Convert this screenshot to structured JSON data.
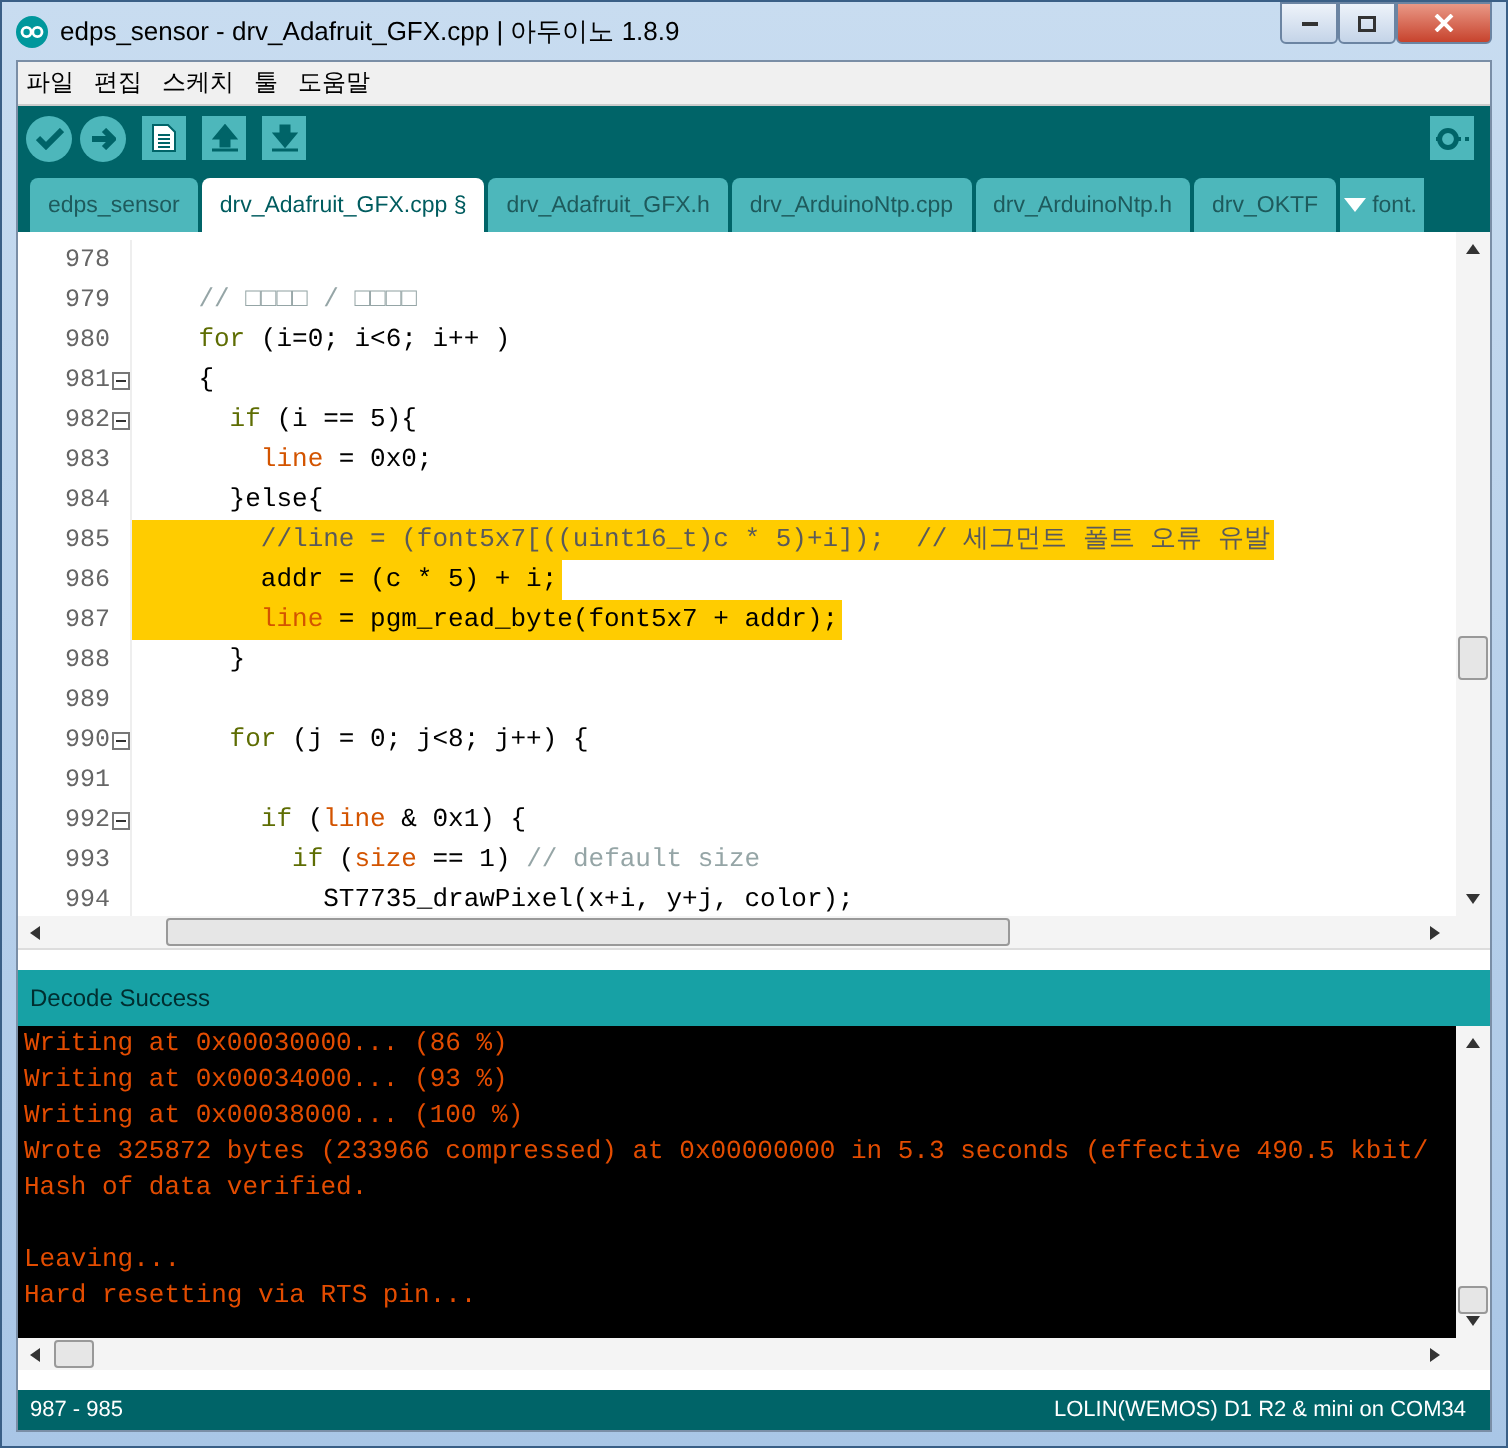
{
  "window": {
    "title": "edps_sensor - drv_Adafruit_GFX.cpp | 아두이노 1.8.9"
  },
  "menu": [
    "파일",
    "편집",
    "스케치",
    "툴",
    "도움말"
  ],
  "toolbar": [
    {
      "kind": "verify"
    },
    {
      "kind": "upload"
    },
    {
      "kind": "new"
    },
    {
      "kind": "open"
    },
    {
      "kind": "save"
    }
  ],
  "tabs": [
    {
      "label": "edps_sensor",
      "selected": false
    },
    {
      "label": "drv_Adafruit_GFX.cpp §",
      "selected": true
    },
    {
      "label": "drv_Adafruit_GFX.h",
      "selected": false
    },
    {
      "label": "drv_ArduinoNtp.cpp",
      "selected": false
    },
    {
      "label": "drv_ArduinoNtp.h",
      "selected": false
    },
    {
      "label": "drv_OKTF",
      "selected": false
    }
  ],
  "tab_overflow": {
    "label": "font."
  },
  "editor": {
    "lines": [
      {
        "number": "978",
        "fold": false,
        "highlighted": false
      },
      {
        "number": "979",
        "fold": false,
        "highlighted": false,
        "tokens": [
          {
            "kind": "comment",
            "text": "    // □□□□ / □□□□"
          }
        ]
      },
      {
        "number": "980",
        "fold": false,
        "highlighted": false,
        "tokens": [
          {
            "kind": "keyword",
            "text": "    for"
          },
          {
            "kind": "plain",
            "text": " (i=0; i<6; i++ )"
          }
        ]
      },
      {
        "number": "981",
        "fold": true,
        "highlighted": false,
        "tokens": [
          {
            "kind": "plain",
            "text": "    {"
          }
        ]
      },
      {
        "number": "982",
        "fold": true,
        "highlighted": false,
        "tokens": [
          {
            "kind": "keyword",
            "text": "      if"
          },
          {
            "kind": "plain",
            "text": " (i == 5){"
          }
        ]
      },
      {
        "number": "983",
        "fold": false,
        "highlighted": false,
        "tokens": [
          {
            "kind": "variable",
            "text": "        line"
          },
          {
            "kind": "plain",
            "text": " = 0x0;"
          }
        ]
      },
      {
        "number": "984",
        "fold": false,
        "highlighted": false,
        "tokens": [
          {
            "kind": "plain",
            "text": "      }else{"
          }
        ]
      },
      {
        "number": "985",
        "fold": false,
        "highlighted": true,
        "tokens": [
          {
            "kind": "comment",
            "text": "        //line = (font5x7[((uint16_t)c * 5)+i]);  // 세그먼트 폴트 오류 유발"
          }
        ]
      },
      {
        "number": "986",
        "fold": false,
        "highlighted": true,
        "tokens": [
          {
            "kind": "plain",
            "text": "        addr = (c * 5) + i;"
          }
        ]
      },
      {
        "number": "987",
        "fold": false,
        "highlighted": true,
        "tokens": [
          {
            "kind": "variable",
            "text": "        line"
          },
          {
            "kind": "plain",
            "text": " = pgm_read_byte(font5x7 + addr);"
          }
        ]
      },
      {
        "number": "988",
        "fold": false,
        "highlighted": false,
        "tokens": [
          {
            "kind": "plain",
            "text": "      }"
          }
        ]
      },
      {
        "number": "989",
        "fold": false,
        "highlighted": false
      },
      {
        "number": "990",
        "fold": true,
        "highlighted": false,
        "tokens": [
          {
            "kind": "keyword",
            "text": "      for"
          },
          {
            "kind": "plain",
            "text": " (j = 0; j<8; j++) {"
          }
        ]
      },
      {
        "number": "991",
        "fold": false,
        "highlighted": false
      },
      {
        "number": "992",
        "fold": true,
        "highlighted": false,
        "tokens": [
          {
            "kind": "keyword",
            "text": "        if"
          },
          {
            "kind": "plain",
            "text": " ("
          },
          {
            "kind": "variable",
            "text": "line"
          },
          {
            "kind": "plain",
            "text": " & 0x1) {"
          }
        ]
      },
      {
        "number": "993",
        "fold": false,
        "highlighted": false,
        "tokens": [
          {
            "kind": "keyword",
            "text": "          if"
          },
          {
            "kind": "plain",
            "text": " ("
          },
          {
            "kind": "variable",
            "text": "size"
          },
          {
            "kind": "plain",
            "text": " == 1) "
          },
          {
            "kind": "comment",
            "text": "// default size"
          }
        ]
      },
      {
        "number": "994",
        "fold": false,
        "highlighted": false,
        "tokens": [
          {
            "kind": "plain",
            "text": "            ST7735_drawPixel(x+i, y+j, color);"
          }
        ]
      }
    ]
  },
  "message": "Decode Success",
  "console": [
    {
      "kind": "text",
      "text": "Writing at 0x00030000... (86 %)"
    },
    {
      "kind": "text",
      "text": "Writing at 0x00034000... (93 %)"
    },
    {
      "kind": "text",
      "text": "Writing at 0x00038000... (100 %)"
    },
    {
      "kind": "text",
      "text": "Wrote 325872 bytes (233966 compressed) at 0x00000000 in 5.3 seconds (effective 490.5 kbit/"
    },
    {
      "kind": "text",
      "text": "Hash of data verified."
    },
    {
      "kind": "blank"
    },
    {
      "kind": "text",
      "text": "Leaving..."
    },
    {
      "kind": "text",
      "text": "Hard resetting via RTS pin..."
    }
  ],
  "status_bar": {
    "lines": "987 - 985",
    "board": "LOLIN(WEMOS) D1 R2 & mini on COM34"
  }
}
